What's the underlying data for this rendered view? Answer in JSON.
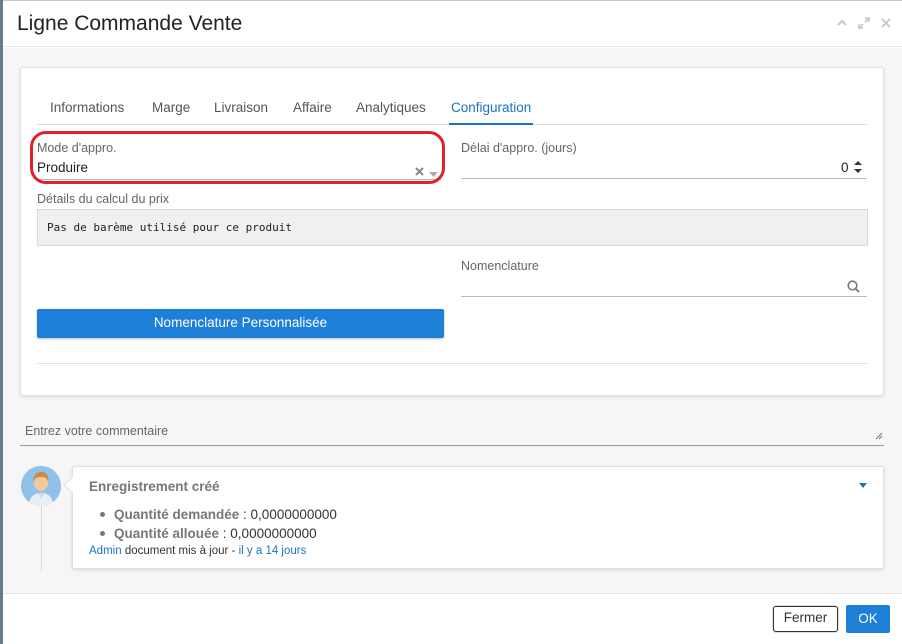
{
  "modal": {
    "title": "Ligne Commande Vente",
    "header_icons": [
      "chevron-up-icon",
      "expand-icon",
      "close-icon"
    ]
  },
  "tabs": [
    {
      "label": "Informations",
      "active": false
    },
    {
      "label": "Marge",
      "active": false
    },
    {
      "label": "Livraison",
      "active": false
    },
    {
      "label": "Affaire",
      "active": false
    },
    {
      "label": "Analytiques",
      "active": false
    },
    {
      "label": "Configuration",
      "active": true
    }
  ],
  "form": {
    "supply_mode": {
      "label": "Mode d'appro.",
      "value": "Produire"
    },
    "supply_delay": {
      "label": "Délai d'appro. (jours)",
      "value": "0"
    },
    "price_details": {
      "label": "Détails du calcul du prix",
      "value": "Pas de barème utilisé pour ce produit"
    },
    "bom": {
      "label": "Nomenclature",
      "value": ""
    },
    "custom_bom_button": "Nomenclature Personnalisée"
  },
  "comment": {
    "placeholder": "Entrez votre commentaire"
  },
  "activity": {
    "title": "Enregistrement créé",
    "changes": [
      {
        "label": "Quantité demandée",
        "value": "0,0000000000"
      },
      {
        "label": "Quantité allouée",
        "value": "0,0000000000"
      }
    ],
    "author": "Admin",
    "action_text": "document mis à jour",
    "separator": "-",
    "time": "il y a 14 jours"
  },
  "footer": {
    "close_label": "Fermer",
    "ok_label": "OK"
  },
  "colors": {
    "accent": "#1e7fd8",
    "highlight": "#e3202a"
  }
}
